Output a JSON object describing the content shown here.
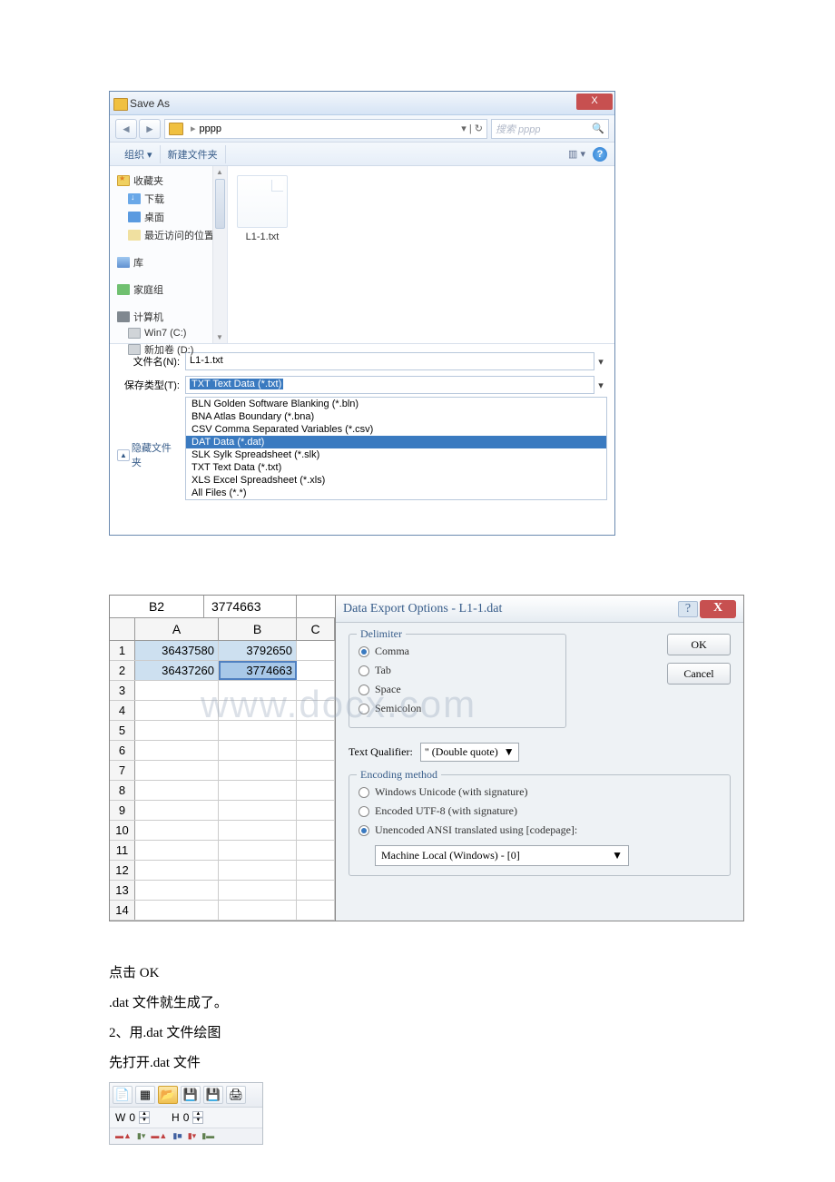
{
  "saveas": {
    "title": "Save As",
    "path_folder": "pppp",
    "search_placeholder": "搜索 pppp",
    "toolbar": {
      "organize": "组织 ▾",
      "newfolder": "新建文件夹"
    },
    "tree": {
      "favorites": "收藏夹",
      "downloads": "下载",
      "desktop": "桌面",
      "recent": "最近访问的位置",
      "libraries": "库",
      "homegroup": "家庭组",
      "computer": "计算机",
      "win7": "Win7 (C:)",
      "newvol": "新加卷 (D:)"
    },
    "file_item": "L1-1.txt",
    "filename_label": "文件名(N):",
    "filename_value": "L1-1.txt",
    "type_label": "保存类型(T):",
    "type_value": "TXT Text Data (*.txt)",
    "types": [
      "BLN Golden Software Blanking (*.bln)",
      "BNA Atlas Boundary (*.bna)",
      "CSV Comma Separated Variables (*.csv)",
      "DAT Data (*.dat)",
      "SLK Sylk Spreadsheet (*.slk)",
      "TXT Text Data (*.txt)",
      "XLS Excel Spreadsheet (*.xls)",
      "All Files (*.*)"
    ],
    "hide_folders": "隐藏文件夹"
  },
  "sheet": {
    "ref": "B2",
    "ref_val": "3774663",
    "cols": [
      "A",
      "B",
      "C"
    ],
    "rows": {
      "1": {
        "A": "36437580",
        "B": "3792650"
      },
      "2": {
        "A": "36437260",
        "B": "3774663"
      }
    },
    "row_count": 14
  },
  "watermark": "www.docx.com",
  "export": {
    "title": "Data Export Options - L1-1.dat",
    "delimiter_legend": "Delimiter",
    "comma": "Comma",
    "tab": "Tab",
    "space": "Space",
    "semicolon": "Semicolon",
    "ok": "OK",
    "cancel": "Cancel",
    "tq_label": "Text Qualifier:",
    "tq_value": "\" (Double quote)",
    "enc_legend": "Encoding method",
    "enc1": "Windows Unicode (with signature)",
    "enc2": "Encoded UTF-8 (with signature)",
    "enc3": "Unencoded ANSI translated using [codepage]:",
    "codepage": "Machine Local (Windows) - [0]"
  },
  "body": {
    "p1": "点击 OK",
    "p2": ".dat 文件就生成了。",
    "p3": "2、用.dat 文件绘图",
    "p4": "先打开.dat 文件"
  },
  "tb2": {
    "W": "W",
    "Wval": "0",
    "H": "H",
    "Hval": "0"
  }
}
